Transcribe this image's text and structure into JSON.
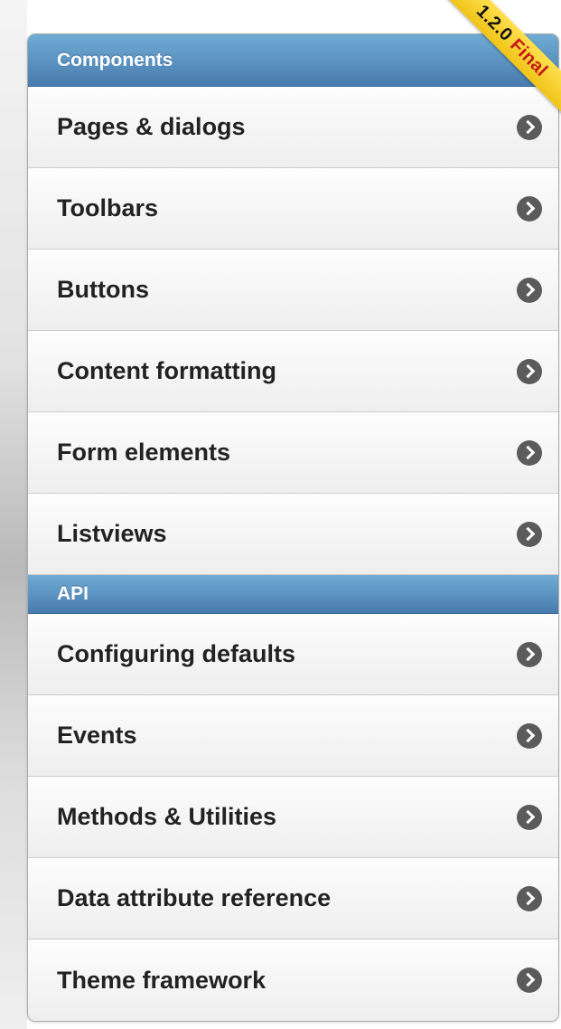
{
  "ribbon": {
    "version": "1.2.0",
    "tag": "Final"
  },
  "sections": {
    "components": {
      "title": "Components",
      "items": [
        {
          "label": "Pages & dialogs"
        },
        {
          "label": "Toolbars"
        },
        {
          "label": "Buttons"
        },
        {
          "label": "Content formatting"
        },
        {
          "label": "Form elements"
        },
        {
          "label": "Listviews"
        }
      ]
    },
    "api": {
      "title": "API",
      "items": [
        {
          "label": "Configuring defaults"
        },
        {
          "label": "Events"
        },
        {
          "label": "Methods & Utilities"
        },
        {
          "label": "Data attribute reference"
        },
        {
          "label": "Theme framework"
        }
      ]
    }
  },
  "icons": {
    "item_icon": "chevron-right-circle-icon"
  },
  "colors": {
    "divider_top": "#6facd5",
    "divider_bottom": "#497bae",
    "ribbon": "#f0c419",
    "ribbon_tag": "#c51717"
  }
}
